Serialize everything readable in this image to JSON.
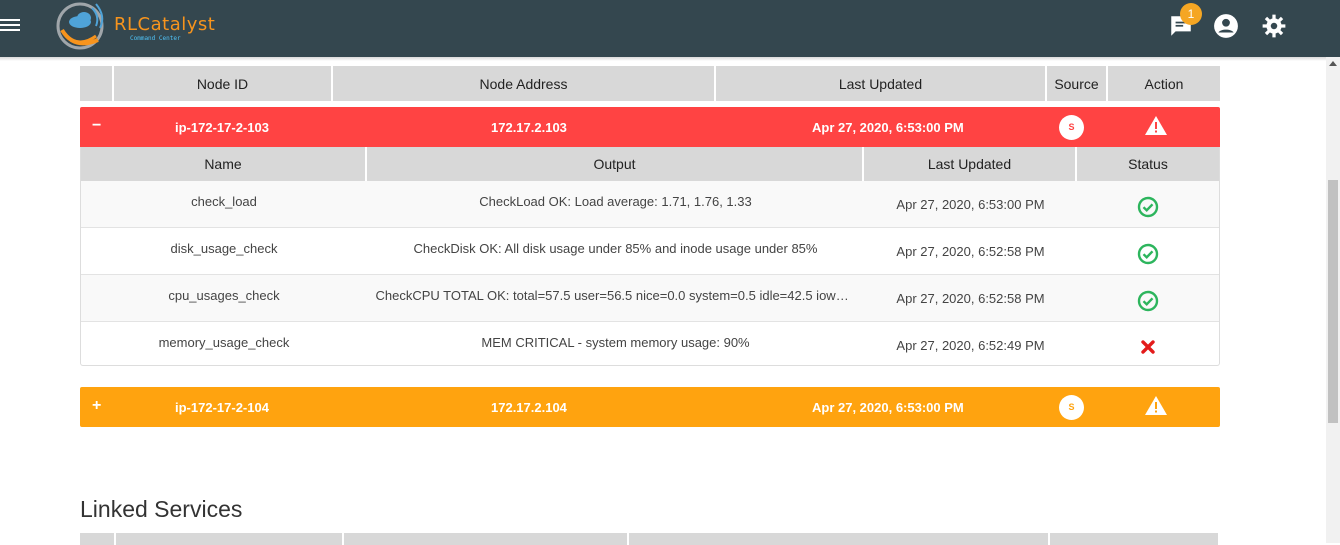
{
  "app": {
    "brand_name": "RLCatalyst",
    "brand_sub": "Command Center",
    "notification_count": "1",
    "icons": [
      "menu-icon",
      "chat-notification-icon",
      "account-icon",
      "settings-icon"
    ]
  },
  "nodes_table": {
    "headers": [
      "",
      "Node ID",
      "Node Address",
      "Last Updated",
      "Source",
      "Action"
    ],
    "nodes": [
      {
        "toggle": "−",
        "node_id": "ip-172-17-2-103",
        "address": "172.17.2.103",
        "last_updated": "Apr 27, 2020, 6:53:00 PM",
        "source": "S",
        "status_color": "#ff4343"
      },
      {
        "toggle": "+",
        "node_id": "ip-172-17-2-104",
        "address": "172.17.2.104",
        "last_updated": "Apr 27, 2020, 6:53:00 PM",
        "source": "S",
        "status_color": "#ffa30f"
      }
    ]
  },
  "checks_table": {
    "headers": [
      "Name",
      "Output",
      "Last Updated",
      "Status"
    ],
    "rows": [
      {
        "name": "check_load",
        "output": "CheckLoad OK: Load average: 1.71, 1.76, 1.33",
        "last_updated": "Apr 27, 2020, 6:53:00 PM",
        "status": "ok"
      },
      {
        "name": "disk_usage_check",
        "output": "CheckDisk OK: All disk usage under 85% and inode usage under 85%",
        "last_updated": "Apr 27, 2020, 6:52:58 PM",
        "status": "ok"
      },
      {
        "name": "cpu_usages_check",
        "output": "CheckCPU TOTAL OK: total=57.5 user=56.5 nice=0.0 system=0.5 idle=42.5 iowa…",
        "last_updated": "Apr 27, 2020, 6:52:58 PM",
        "status": "ok"
      },
      {
        "name": "memory_usage_check",
        "output": "MEM CRITICAL - system memory usage: 90%",
        "last_updated": "Apr 27, 2020, 6:52:49 PM",
        "status": "critical"
      }
    ]
  },
  "linked_services": {
    "title": "Linked Services"
  },
  "colors": {
    "topbar": "#34474f",
    "critical": "#ff4343",
    "warning": "#ffa30f",
    "ok_green": "#2db55d",
    "fail_red": "#e31b1b"
  }
}
